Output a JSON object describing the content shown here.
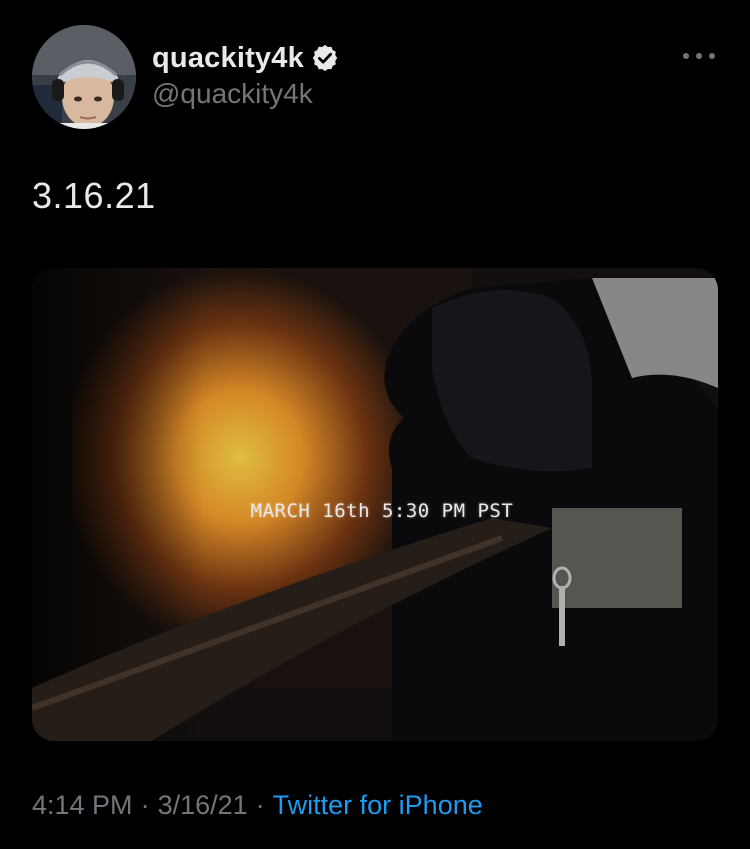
{
  "colors": {
    "background": "#000000",
    "primary_text": "#e7e9ea",
    "secondary_text": "#71767b",
    "link": "#1d9bf0",
    "verified_badge": "#e7e9ea"
  },
  "tweet": {
    "author": {
      "display_name": "quackity4k",
      "handle": "@quackity4k",
      "verified": true,
      "avatar_icon": "user-avatar"
    },
    "more_icon": "ellipsis-icon",
    "text": "3.16.21",
    "media": {
      "type": "image",
      "caption": "MARCH 16th 5:30 PM PST"
    },
    "meta": {
      "time": "4:14 PM",
      "separator": "·",
      "date": "3/16/21",
      "source": "Twitter for iPhone"
    }
  }
}
